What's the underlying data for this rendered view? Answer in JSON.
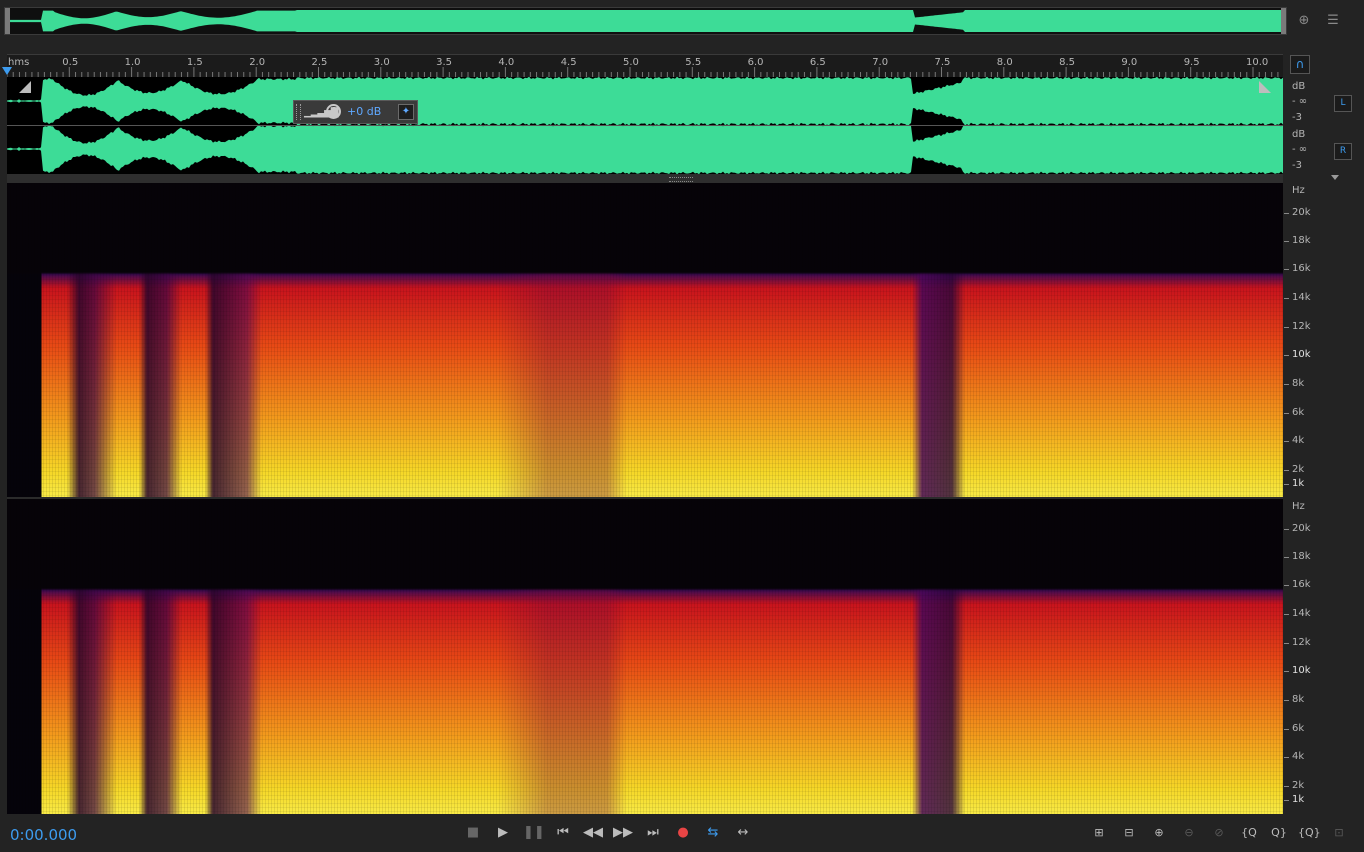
{
  "ruler": {
    "unit_label": "hms",
    "tick_labels": [
      "0.5",
      "1.0",
      "1.5",
      "2.0",
      "2.5",
      "3.0",
      "3.5",
      "4.0",
      "4.5",
      "5.0",
      "5.5",
      "6.0",
      "6.5",
      "7.0",
      "7.5",
      "8.0",
      "8.5",
      "9.0",
      "9.5",
      "10.0"
    ]
  },
  "hud": {
    "gain": "+0 dB"
  },
  "waveform": {
    "left_channel": {
      "db_label": "dB",
      "inf_label": "- ∞",
      "minus3_label": "-3",
      "button": "L"
    },
    "right_channel": {
      "db_label": "dB",
      "inf_label": "- ∞",
      "minus3_label": "-3",
      "button": "R"
    }
  },
  "spectral": {
    "unit": "Hz",
    "freq_labels": [
      "20k",
      "18k",
      "16k",
      "14k",
      "12k",
      "10k",
      "8k",
      "6k",
      "4k",
      "2k",
      "1k"
    ]
  },
  "transport": {
    "time": "0:00.000",
    "buttons": [
      "stop",
      "play",
      "pause",
      "go-to-start",
      "rewind",
      "fast-forward",
      "go-to-end",
      "record",
      "loop",
      "skip-selection"
    ]
  },
  "zoom": {
    "buttons": [
      "zoom-in-amplitude",
      "zoom-out-amplitude",
      "zoom-in",
      "zoom-out",
      "zoom-in-at-playhead",
      "zoom-out-full",
      "zoom-in-left",
      "zoom-in-right",
      "zoom-selection",
      "zoom-reset"
    ]
  },
  "colors": {
    "waveform": "#3ddc97",
    "accent": "#3d9cf0",
    "record": "#e84545"
  }
}
